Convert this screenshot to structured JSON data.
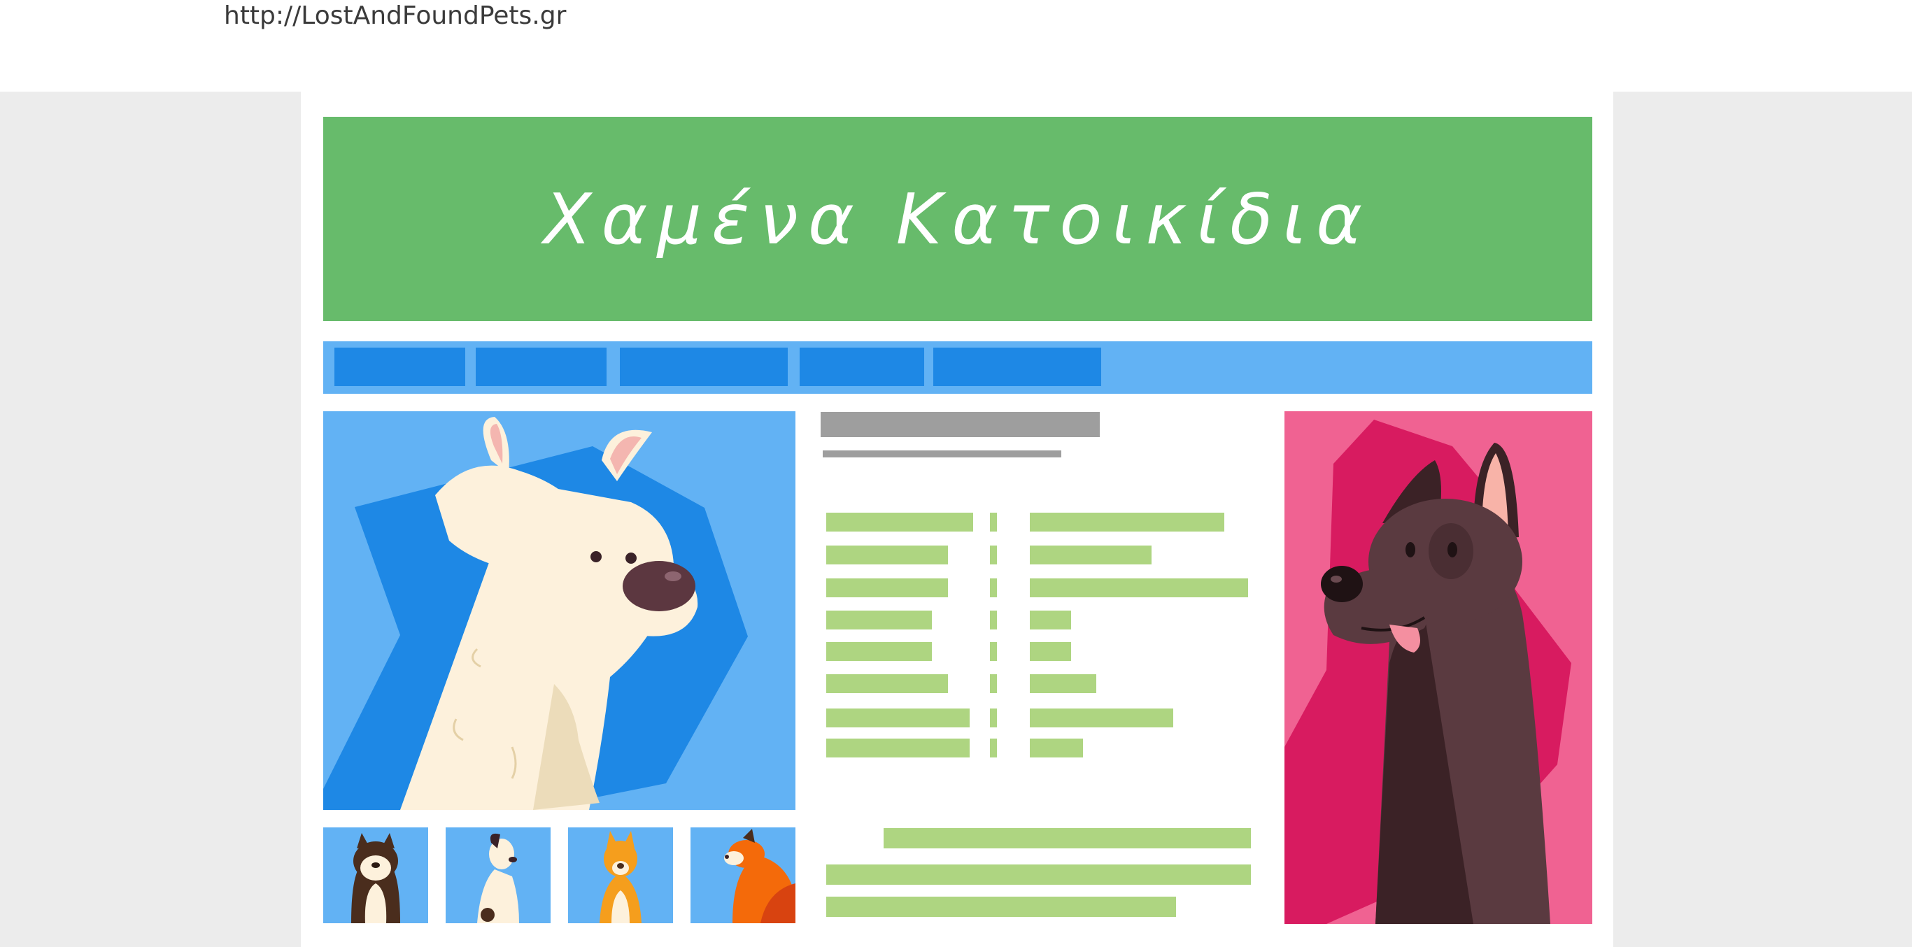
{
  "browser": {
    "url": "http://LostAndFoundPets.gr"
  },
  "header": {
    "title": "Χαμένα Κατοικίδια"
  },
  "nav": {
    "items": [
      "",
      "",
      "",
      "",
      ""
    ]
  },
  "colors": {
    "banner": "#67bb6b",
    "nav_bar": "#62b2f4",
    "nav_item": "#1e88e5",
    "placeholder_gray": "#9e9e9e",
    "placeholder_green": "#aed581",
    "ad_pink": "#f06292",
    "ad_magenta": "#d81b60"
  },
  "images": {
    "hero": "white-terrier-dog-illustration",
    "thumbnails": [
      "husky-dog-thumbnail",
      "spotted-dog-thumbnail",
      "orange-dog-thumbnail",
      "fox-thumbnail"
    ],
    "ad": "dark-dog-illustration"
  }
}
